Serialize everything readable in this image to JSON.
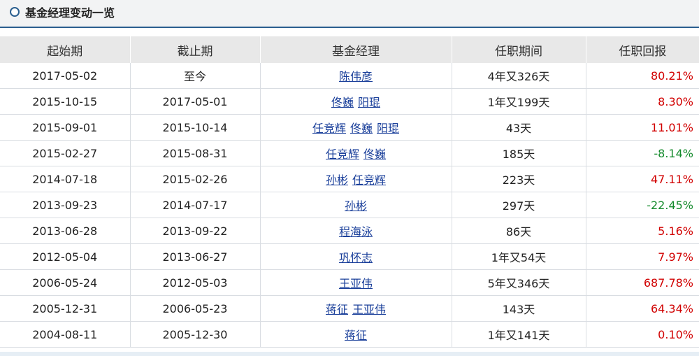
{
  "header": {
    "title": "基金经理变动一览",
    "icon": "circle-bullet-icon"
  },
  "columns": [
    "起始期",
    "截止期",
    "基金经理",
    "任职期间",
    "任职回报"
  ],
  "colors": {
    "positive": "#d10000",
    "negative": "#138a2b",
    "link": "#1a3f9a",
    "accent": "#2b5f8f"
  },
  "rows": [
    {
      "start": "2017-05-02",
      "end": "至今",
      "managers": [
        "陈伟彦"
      ],
      "tenure": "4年又326天",
      "return": "80.21%",
      "sign": "pos"
    },
    {
      "start": "2015-10-15",
      "end": "2017-05-01",
      "managers": [
        "佟巍",
        "阳琨"
      ],
      "tenure": "1年又199天",
      "return": "8.30%",
      "sign": "pos"
    },
    {
      "start": "2015-09-01",
      "end": "2015-10-14",
      "managers": [
        "任竞辉",
        "佟巍",
        "阳琨"
      ],
      "tenure": "43天",
      "return": "11.01%",
      "sign": "pos"
    },
    {
      "start": "2015-02-27",
      "end": "2015-08-31",
      "managers": [
        "任竞辉",
        "佟巍"
      ],
      "tenure": "185天",
      "return": "-8.14%",
      "sign": "neg"
    },
    {
      "start": "2014-07-18",
      "end": "2015-02-26",
      "managers": [
        "孙彬",
        "任竞辉"
      ],
      "tenure": "223天",
      "return": "47.11%",
      "sign": "pos"
    },
    {
      "start": "2013-09-23",
      "end": "2014-07-17",
      "managers": [
        "孙彬"
      ],
      "tenure": "297天",
      "return": "-22.45%",
      "sign": "neg"
    },
    {
      "start": "2013-06-28",
      "end": "2013-09-22",
      "managers": [
        "程海泳"
      ],
      "tenure": "86天",
      "return": "5.16%",
      "sign": "pos"
    },
    {
      "start": "2012-05-04",
      "end": "2013-06-27",
      "managers": [
        "巩怀志"
      ],
      "tenure": "1年又54天",
      "return": "7.97%",
      "sign": "pos"
    },
    {
      "start": "2006-05-24",
      "end": "2012-05-03",
      "managers": [
        "王亚伟"
      ],
      "tenure": "5年又346天",
      "return": "687.78%",
      "sign": "pos"
    },
    {
      "start": "2005-12-31",
      "end": "2006-05-23",
      "managers": [
        "蒋征",
        "王亚伟"
      ],
      "tenure": "143天",
      "return": "64.34%",
      "sign": "pos"
    },
    {
      "start": "2004-08-11",
      "end": "2005-12-30",
      "managers": [
        "蒋征"
      ],
      "tenure": "1年又141天",
      "return": "0.10%",
      "sign": "pos"
    }
  ]
}
